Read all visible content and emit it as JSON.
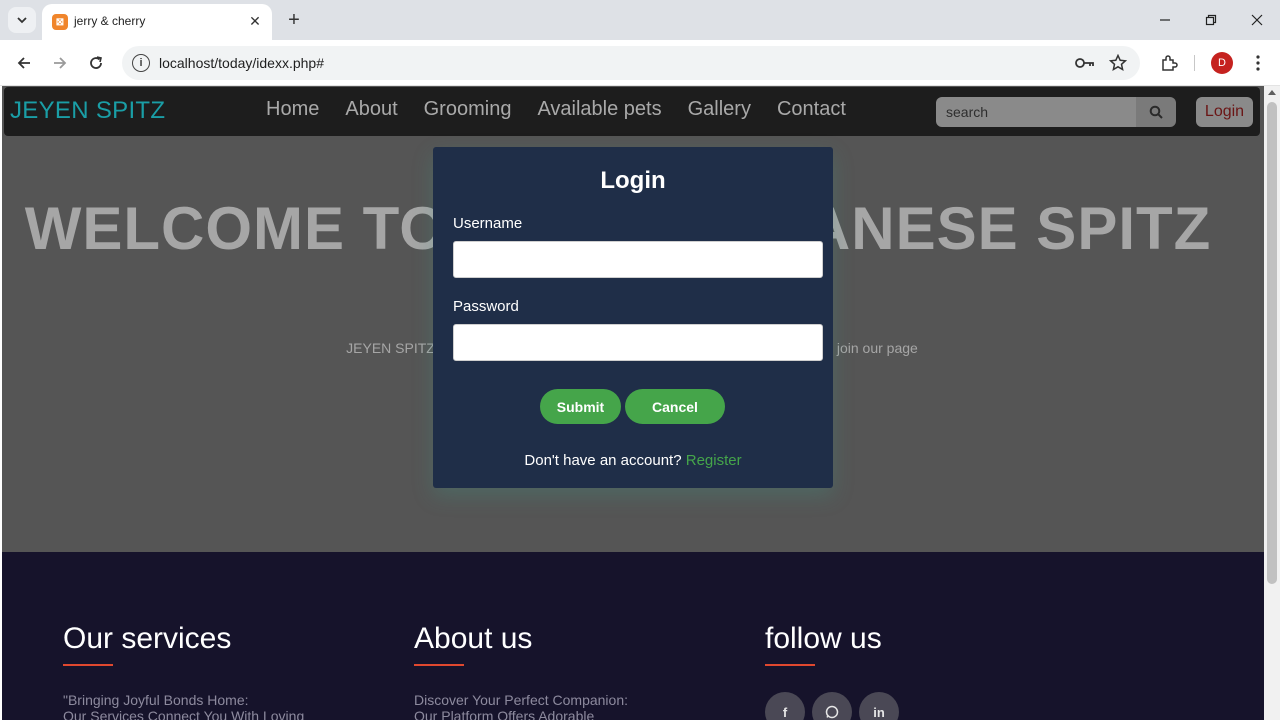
{
  "browser": {
    "tab_title": "jerry & cherry",
    "url": "localhost/today/idexx.php#",
    "profile_initial": "D"
  },
  "site": {
    "brand": "JEYEN SPITZ",
    "nav": [
      "Home",
      "About",
      "Grooming",
      "Available pets",
      "Gallery",
      "Contact"
    ],
    "search_placeholder": "search",
    "login_label": "Login"
  },
  "hero": {
    "title_left": "WELCOME TO",
    "title_right": "ANESE SPITZ",
    "subtitle_left": "JEYEN SPITZ",
    "subtitle_right": "join our page"
  },
  "modal": {
    "title": "Login",
    "username_label": "Username",
    "password_label": "Password",
    "submit_label": "Submit",
    "cancel_label": "Cancel",
    "no_account_text": "Don't have an account?",
    "register_label": "Register"
  },
  "footer": {
    "services": {
      "heading": "Our services",
      "text_line1": "\"Bringing Joyful Bonds Home:",
      "text_line2": "Our Services Connect You With Loving"
    },
    "about": {
      "heading": "About us",
      "text_line1": "Discover Your Perfect Companion:",
      "text_line2": "Our Platform Offers Adorable"
    },
    "follow": {
      "heading": "follow us",
      "socials": [
        "facebook-icon",
        "whatsapp-icon",
        "linkedin-icon"
      ]
    }
  },
  "colors": {
    "brand": "#1a9ea6",
    "modal_bg": "#1f2e48",
    "accent_green": "#45a54a",
    "footer_bg": "#16132b",
    "footer_accent": "#e0482f"
  }
}
